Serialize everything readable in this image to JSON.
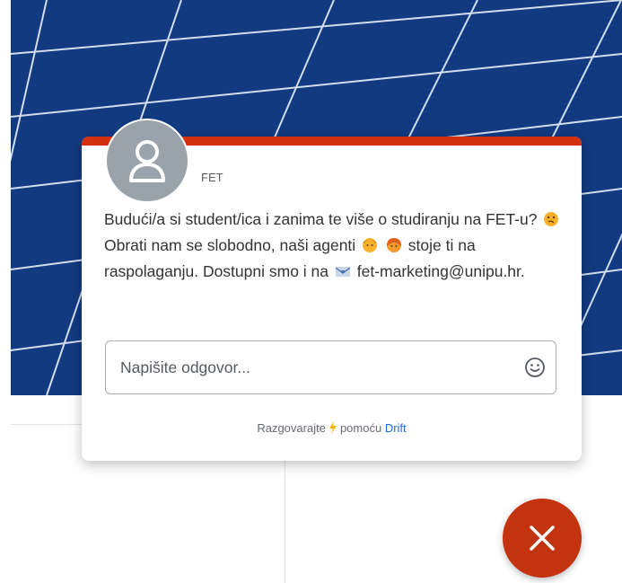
{
  "chat": {
    "sender": "FET",
    "message": {
      "part1": "Budući/a si student/ica i zanima te više o studiranju na FET-u? ",
      "part2": " Obrati nam se slobodno, naši agenti ",
      "part3": " stoje ti na raspolaganju. Dostupni smo i na ",
      "part4": " fet-marketing@unipu.hr."
    },
    "reply_placeholder": "Napišite odgovor...",
    "powered_prefix": "Razgovarajte",
    "powered_middle": "pomoću",
    "powered_brand": "Drift"
  },
  "icons": {
    "avatar": "user-silhouette-icon",
    "emoji_picker": "smiley-icon",
    "bolt": "lightning-icon",
    "close": "close-icon",
    "thinking": "thinking-emoji",
    "agent1": "man-emoji",
    "agent2": "woman-emoji",
    "mail": "envelope-emoji"
  },
  "colors": {
    "accent": "#d2300e",
    "close_button": "#c4330f",
    "brand_link": "#1f6bd8",
    "background_photo": "#123a80"
  }
}
